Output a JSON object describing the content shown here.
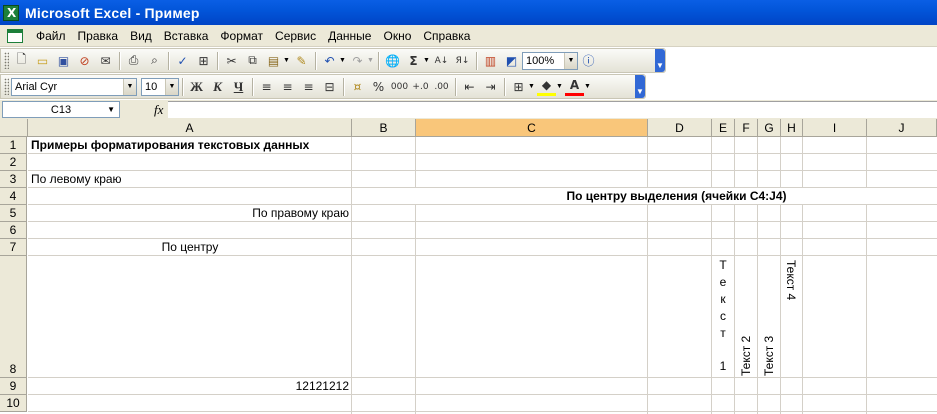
{
  "window": {
    "title": "Microsoft Excel - Пример",
    "app_icon": "excel-icon"
  },
  "menu": [
    "Файл",
    "Правка",
    "Вид",
    "Вставка",
    "Формат",
    "Сервис",
    "Данные",
    "Окно",
    "Справка"
  ],
  "toolbar_standard": {
    "zoom": "100%"
  },
  "toolbar_format": {
    "font": "Arial Cyr",
    "size": "10",
    "bold": "Ж",
    "italic": "К",
    "underline": "Ч",
    "percent": "%",
    "thousands": "000"
  },
  "formula_bar": {
    "name_box": "C13",
    "fx": "fx",
    "formula": ""
  },
  "columns": [
    "A",
    "B",
    "C",
    "D",
    "E",
    "F",
    "G",
    "H",
    "I",
    "J"
  ],
  "selected_column": "C",
  "rows": [
    "1",
    "2",
    "3",
    "4",
    "5",
    "6",
    "7",
    "8",
    "9",
    "10"
  ],
  "cells": {
    "A1": "Примеры форматирования текстовых данных",
    "A3": "По левому краю",
    "C4": "По центру выделения (ячейки C4:J4)",
    "A5": "По правому краю",
    "A7": "По центру",
    "E8_stacked": [
      "Т",
      "е",
      "к",
      "с",
      "т",
      "",
      "1"
    ],
    "F8": "Текст 2",
    "G8": "Текст 3",
    "H8": "Текст 4",
    "A9": "12121212"
  }
}
